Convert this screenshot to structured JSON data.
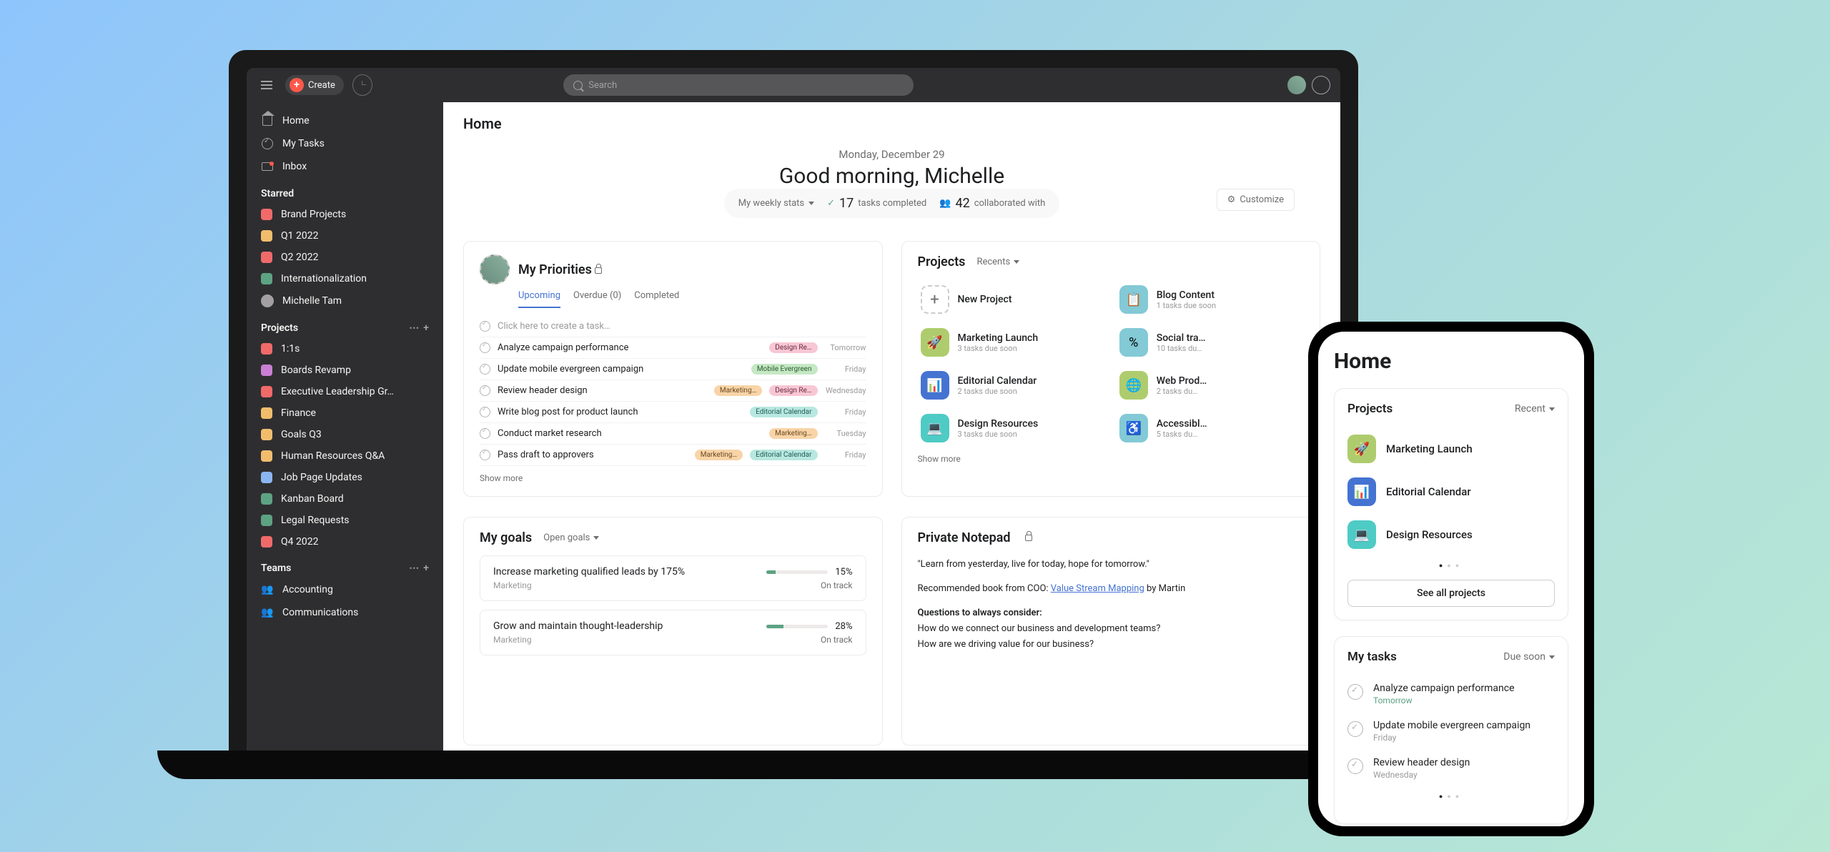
{
  "topbar": {
    "create_label": "Create",
    "search_placeholder": "Search"
  },
  "sidebar": {
    "nav": {
      "home": "Home",
      "my_tasks": "My Tasks",
      "inbox": "Inbox"
    },
    "starred_label": "Starred",
    "starred": [
      {
        "name": "Brand Projects",
        "color": "#f06a6a"
      },
      {
        "name": "Q1 2022",
        "color": "#f1bd6c"
      },
      {
        "name": "Q2 2022",
        "color": "#f06a6a"
      },
      {
        "name": "Internationalization",
        "color": "#5da283"
      },
      {
        "name": "Michelle Tam",
        "type": "person"
      }
    ],
    "projects_label": "Projects",
    "projects": [
      {
        "name": "1:1s",
        "color": "#f06a6a"
      },
      {
        "name": "Boards Revamp",
        "color": "#c97fd4"
      },
      {
        "name": "Executive Leadership Gr…",
        "color": "#f06a6a"
      },
      {
        "name": "Finance",
        "color": "#f1bd6c"
      },
      {
        "name": "Goals Q3",
        "color": "#f1bd6c"
      },
      {
        "name": "Human Resources Q&A",
        "color": "#f1bd6c"
      },
      {
        "name": "Job Page Updates",
        "color": "#8ab5f0"
      },
      {
        "name": "Kanban Board",
        "color": "#5da283"
      },
      {
        "name": "Legal Requests",
        "color": "#5da283"
      },
      {
        "name": "Q4 2022",
        "color": "#f06a6a"
      }
    ],
    "teams_label": "Teams",
    "teams": [
      {
        "name": "Accounting"
      },
      {
        "name": "Communications"
      }
    ]
  },
  "page": {
    "title": "Home",
    "date": "Monday, December 29",
    "greeting": "Good morning, Michelle",
    "stats_dropdown": "My weekly stats",
    "tasks_completed_num": "17",
    "tasks_completed_label": "tasks completed",
    "collab_num": "42",
    "collab_label": "collaborated with",
    "customize_label": "Customize"
  },
  "priorities": {
    "title": "My Priorities",
    "tabs": {
      "upcoming": "Upcoming",
      "overdue": "Overdue (0)",
      "completed": "Completed"
    },
    "placeholder": "Click here to create a task…",
    "tasks": [
      {
        "name": "Analyze campaign performance",
        "tags": [
          {
            "text": "Design Re…",
            "cls": "tag-pink"
          }
        ],
        "due": "Tomorrow"
      },
      {
        "name": "Update mobile evergreen campaign",
        "tags": [
          {
            "text": "Mobile Evergreen",
            "cls": "tag-green"
          }
        ],
        "due": "Friday"
      },
      {
        "name": "Review header design",
        "tags": [
          {
            "text": "Marketing…",
            "cls": "tag-orange"
          },
          {
            "text": "Design Re…",
            "cls": "tag-pink"
          }
        ],
        "due": "Wednesday"
      },
      {
        "name": "Write blog post for product launch",
        "tags": [
          {
            "text": "Editorial Calendar",
            "cls": "tag-teal"
          }
        ],
        "due": "Friday"
      },
      {
        "name": "Conduct market research",
        "tags": [
          {
            "text": "Marketing…",
            "cls": "tag-orange"
          }
        ],
        "due": "Tuesday"
      },
      {
        "name": "Pass draft to approvers",
        "tags": [
          {
            "text": "Marketing…",
            "cls": "tag-orange"
          },
          {
            "text": "Editorial Calendar",
            "cls": "tag-teal"
          }
        ],
        "due": "Friday"
      }
    ],
    "show_more": "Show more"
  },
  "projects_card": {
    "title": "Projects",
    "recents": "Recents",
    "items": [
      {
        "name": "New Project",
        "sub": "",
        "new": true
      },
      {
        "name": "Blog Content",
        "sub": "1 tasks due soon",
        "color": "#83c9d6",
        "glyph": "📋"
      },
      {
        "name": "Marketing Launch",
        "sub": "3 tasks due soon",
        "color": "#aecc6d",
        "glyph": "🚀"
      },
      {
        "name": "Social tra…",
        "sub": "10 tasks du…",
        "color": "#83c9d6",
        "glyph": "%"
      },
      {
        "name": "Editorial Calendar",
        "sub": "2 tasks due soon",
        "color": "#4573d2",
        "glyph": "📊"
      },
      {
        "name": "Web Prod…",
        "sub": "2 tasks du…",
        "color": "#aecc6d",
        "glyph": "🌐"
      },
      {
        "name": "Design Resources",
        "sub": "3 tasks due soon",
        "color": "#4ecbc4",
        "glyph": "💻"
      },
      {
        "name": "Accessibl…",
        "sub": "5 tasks du…",
        "color": "#83c9d6",
        "glyph": "♿"
      }
    ],
    "show_more": "Show more"
  },
  "goals": {
    "title": "My goals",
    "filter": "Open goals",
    "items": [
      {
        "name": "Increase marketing qualified leads by 175%",
        "team": "Marketing",
        "pct": "15%",
        "pct_val": 15,
        "status": "On track"
      },
      {
        "name": "Grow and maintain thought-leadership",
        "team": "Marketing",
        "pct": "28%",
        "pct_val": 28,
        "status": "On track"
      }
    ]
  },
  "notepad": {
    "title": "Private Notepad",
    "quote": "\"Learn from yesterday, live for today, hope for tomorrow.\"",
    "book_prefix": "Recommended book from COO: ",
    "book_link": "Value Stream Mapping",
    "book_suffix": " by Martin",
    "q_head": "Questions to always consider:",
    "q1": "How do we connect our business and development teams?",
    "q2": "How are we driving value for our business?"
  },
  "phone": {
    "title": "Home",
    "projects_label": "Projects",
    "recent_label": "Recent",
    "projects": [
      {
        "name": "Marketing Launch",
        "color": "#aecc6d",
        "glyph": "🚀"
      },
      {
        "name": "Editorial Calendar",
        "color": "#4573d2",
        "glyph": "📊"
      },
      {
        "name": "Design Resources",
        "color": "#4ecbc4",
        "glyph": "💻"
      }
    ],
    "see_all": "See all projects",
    "tasks_label": "My tasks",
    "due_soon": "Due soon",
    "tasks": [
      {
        "name": "Analyze campaign performance",
        "due": "Tomorrow",
        "green": true
      },
      {
        "name": "Update mobile evergreen campaign",
        "due": "Friday",
        "green": false
      },
      {
        "name": "Review header design",
        "due": "Wednesday",
        "green": false
      }
    ]
  }
}
